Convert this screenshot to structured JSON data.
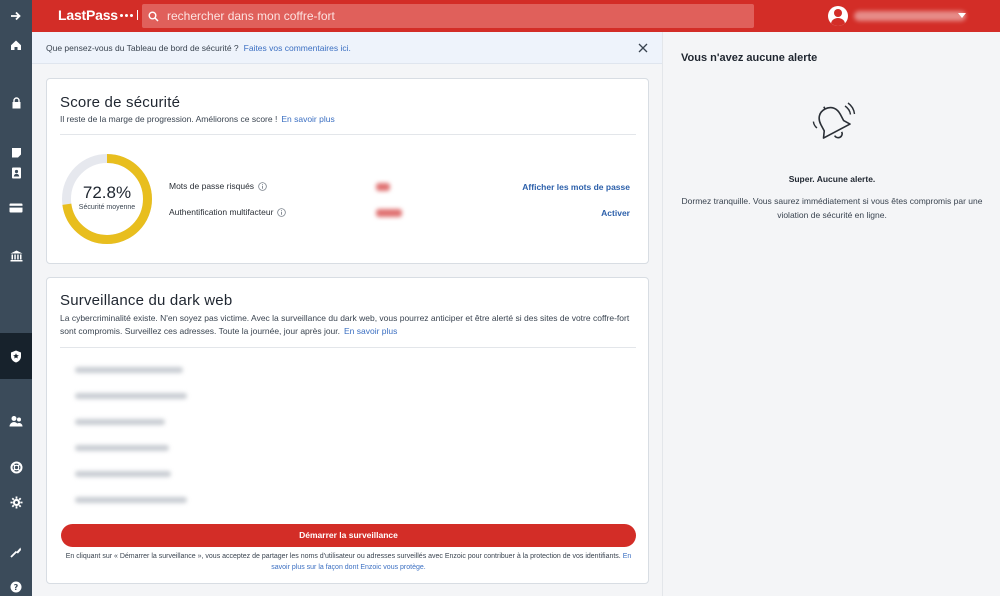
{
  "topbar": {
    "brand": "LastPass",
    "search_placeholder": "rechercher dans mon coffre-fort"
  },
  "sidebar": {
    "items": [
      {
        "icon": "arrow-right-icon"
      },
      {
        "icon": "home-icon"
      },
      {
        "icon": "lock-icon"
      },
      {
        "icon": "note-icon"
      },
      {
        "icon": "address-icon"
      },
      {
        "icon": "card-icon"
      },
      {
        "icon": "bank-icon"
      },
      {
        "icon": "security-dashboard-icon",
        "active": true
      },
      {
        "icon": "sharing-icon"
      },
      {
        "icon": "help-icon"
      },
      {
        "icon": "settings-icon"
      },
      {
        "icon": "tools-icon"
      },
      {
        "icon": "question-icon"
      }
    ]
  },
  "feedback": {
    "text": "Que pensez-vous du Tableau de bord de sécurité ?",
    "link": "Faites vos commentaires ici."
  },
  "score": {
    "title": "Score de sécurité",
    "subtitle": "Il reste de la marge de progression. Améliorons ce score !",
    "learn_more": "En savoir plus",
    "value": "72.8%",
    "value_fraction": 0.728,
    "caption": "Sécurité moyenne",
    "metrics": [
      {
        "label": "Mots de passe risqués",
        "action": "Afficher les mots de passe"
      },
      {
        "label": "Authentification multifacteur",
        "action": "Activer"
      }
    ]
  },
  "darkweb": {
    "title": "Surveillance du dark web",
    "description": "La cybercriminalité existe. N'en soyez pas victime. Avec la surveillance du dark web, vous pourrez anticiper et être alerté si des sites de votre coffre-fort sont compromis. Surveillez ces adresses. Toute la journée, jour après jour.",
    "learn_more": "En savoir plus",
    "cta": "Démarrer la surveillance",
    "legal": "En cliquant sur « Démarrer la surveillance », vous acceptez de partager les noms d'utilisateur ou adresses surveillés avec Enzoic pour contribuer à la protection de vos identifiants.",
    "legal_link": "En savoir plus sur la façon dont Enzoic vous protège."
  },
  "alerts": {
    "title": "Vous n'avez aucune alerte",
    "headline": "Super. Aucune alerte.",
    "text": "Dormez tranquille. Vous saurez immédiatement si vous êtes compromis par une violation de sécurité en ligne."
  },
  "colors": {
    "brand_red": "#d32d27",
    "gauge_yellow": "#e8be1e",
    "gauge_track": "#e6e8ee",
    "link_blue": "#3b6fc2",
    "sidebar": "#3b4b5a"
  }
}
